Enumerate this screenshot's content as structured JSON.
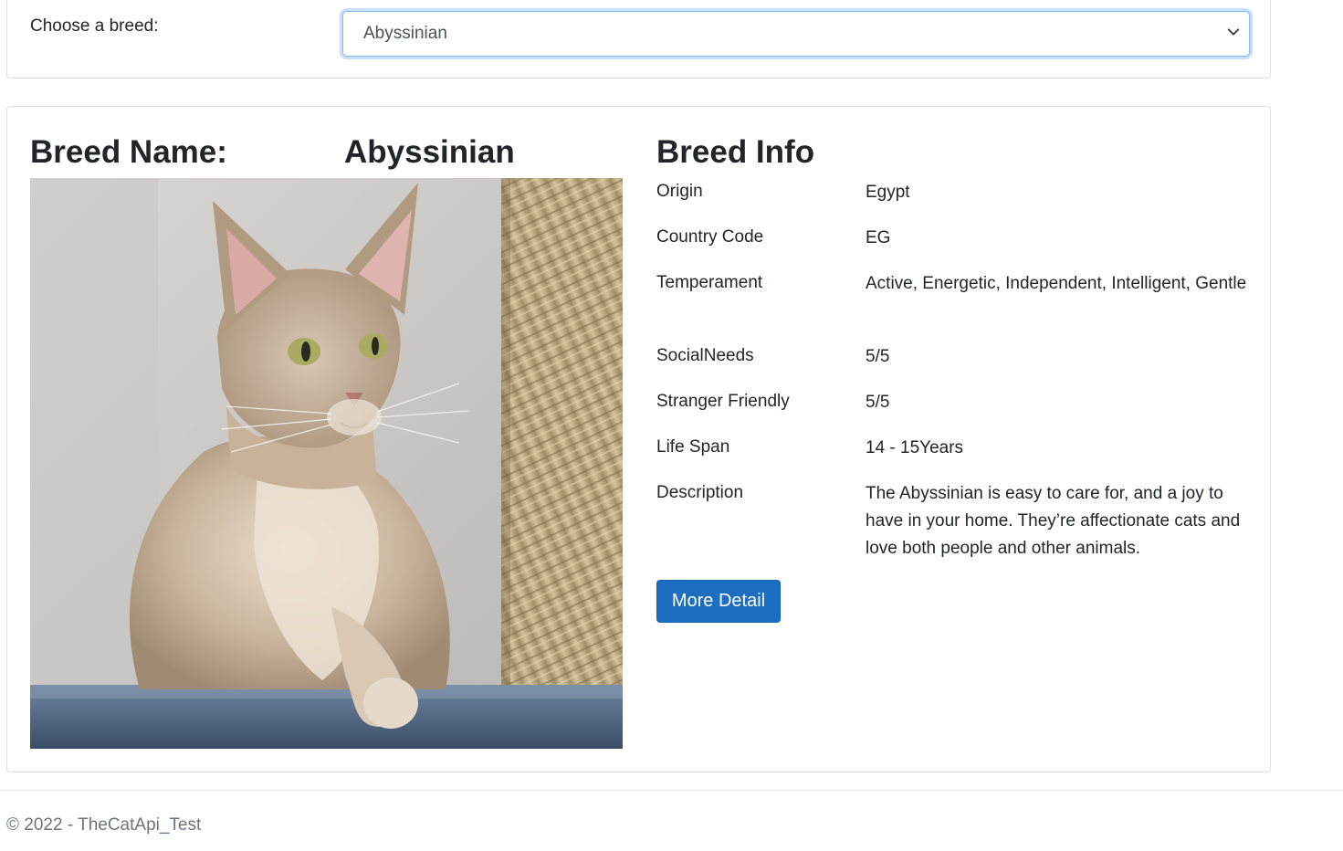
{
  "breed_selector": {
    "label": "Choose a breed:",
    "selected": "Abyssinian"
  },
  "breed": {
    "name_heading": "Breed Name:",
    "name": "Abyssinian",
    "image_alt": "Abyssinian cat"
  },
  "info": {
    "heading": "Breed Info",
    "rows": [
      {
        "label": "Origin",
        "value": "Egypt"
      },
      {
        "label": "Country Code",
        "value": "EG"
      },
      {
        "label": "Temperament",
        "value": "Active, Energetic, Independent, Intelligent, Gentle"
      },
      {
        "label": "SocialNeeds",
        "value": "5/5"
      },
      {
        "label": "Stranger Friendly",
        "value": "5/5"
      },
      {
        "label": "Life Span",
        "value": "14 - 15Years"
      },
      {
        "label": "Description",
        "value": "The Abyssinian is easy to care for, and a joy to have in your home. They’re affectionate cats and love both people and other animals."
      }
    ],
    "more_button": "More Detail"
  },
  "footer": {
    "text": "© 2022 - TheCatApi_Test"
  },
  "colors": {
    "button": "#1b6ec2",
    "select_focus": "#86b7fe"
  },
  "icons": {
    "select": "chevron-down-icon"
  }
}
